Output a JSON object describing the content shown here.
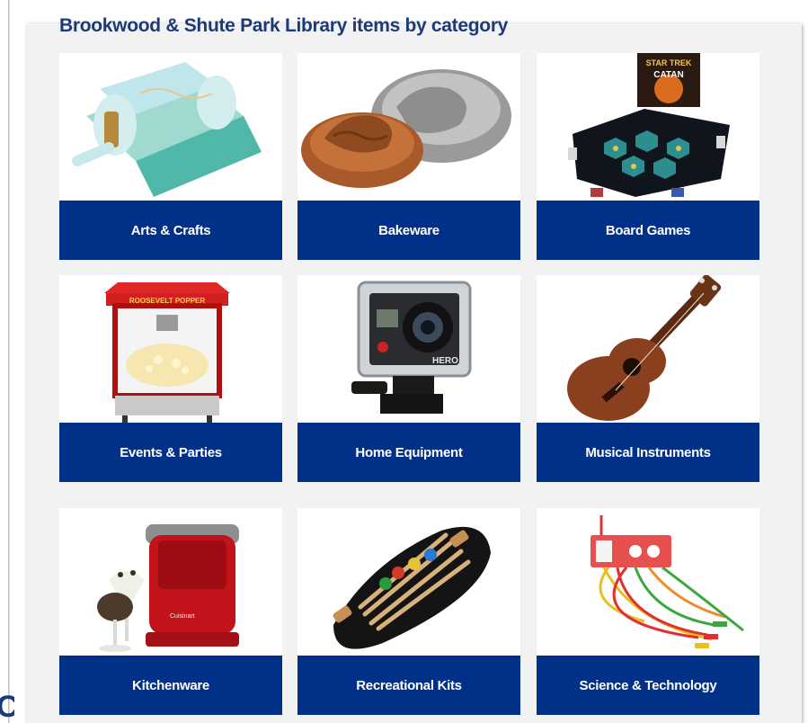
{
  "page": {
    "title": "Brookwood & Shute Park Library items by category",
    "partial_glyph": "C"
  },
  "colors": {
    "label_bar": "#003087",
    "title_text": "#1d3a78",
    "panel_bg": "#f2f2f2"
  },
  "categories": [
    {
      "label": "Arts & Crafts",
      "image": "die-cutting-machine-icon"
    },
    {
      "label": "Bakeware",
      "image": "bundt-pan-icon"
    },
    {
      "label": "Board Games",
      "image": "board-game-icon",
      "box_title_1": "STAR TREK",
      "box_title_2": "CATAN"
    },
    {
      "label": "Events & Parties",
      "image": "popcorn-machine-icon",
      "sign_text": "ROOSEVELT POPPER"
    },
    {
      "label": "Home Equipment",
      "image": "action-camera-icon",
      "brand_text": "HERO"
    },
    {
      "label": "Musical Instruments",
      "image": "ukulele-icon"
    },
    {
      "label": "Kitchenware",
      "image": "ice-cream-maker-icon",
      "brand_text": "Cuisinart"
    },
    {
      "label": "Recreational Kits",
      "image": "croquet-set-icon"
    },
    {
      "label": "Science & Technology",
      "image": "circuit-kit-icon"
    }
  ]
}
